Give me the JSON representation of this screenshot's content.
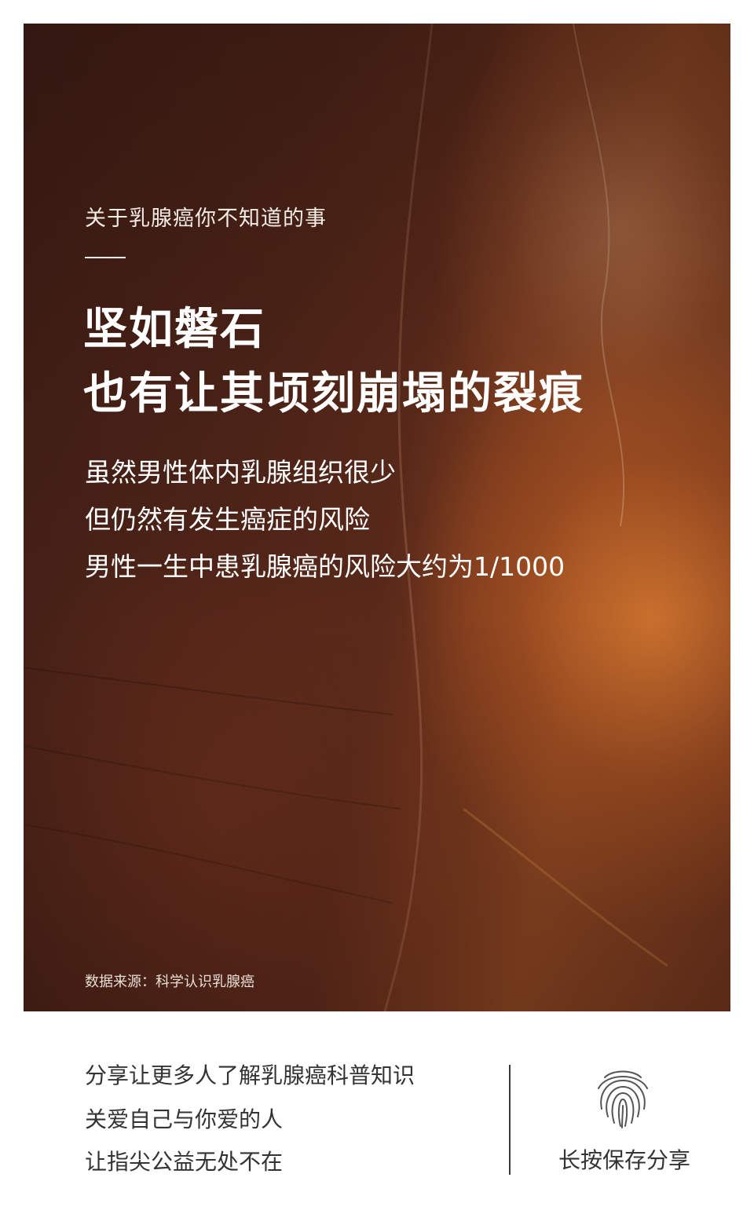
{
  "poster": {
    "kicker": "关于乳腺癌你不知道的事",
    "headline": [
      "坚如磐石",
      "也有让其顷刻崩塌的裂痕"
    ],
    "body": [
      "虽然男性体内乳腺组织很少",
      "但仍然有发生癌症的风险",
      "男性一生中患乳腺癌的风险大约为1/1000"
    ],
    "source": "数据来源：科学认识乳腺癌"
  },
  "footer": {
    "lines": [
      "分享让更多人了解乳腺癌科普知识",
      "关爱自己与你爱的人",
      "让指尖公益无处不在"
    ],
    "save_icon": "fingerprint-icon",
    "save_label": "长按保存分享"
  },
  "colors": {
    "poster_dark": "#3e1d15",
    "poster_orange": "#d67830",
    "text_light": "#ffffff",
    "footer_text": "#333333"
  }
}
